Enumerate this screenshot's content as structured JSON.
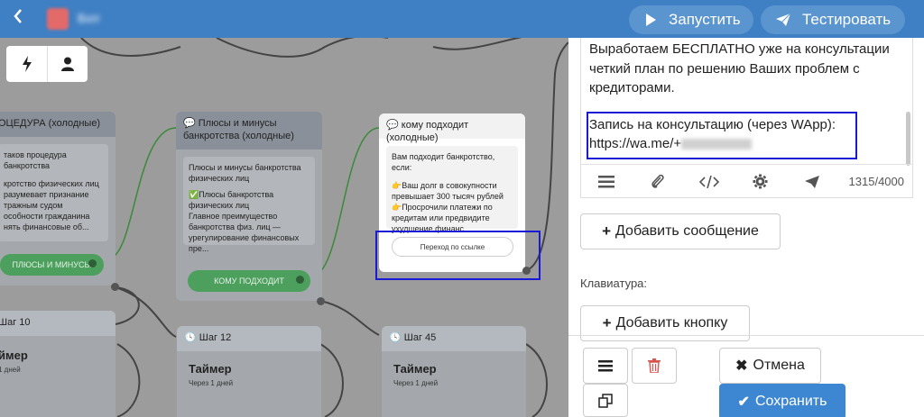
{
  "header": {
    "back_icon": "chevron-left-icon",
    "bot_name": "Бот",
    "run_label": "Запустить",
    "test_label": "Тестировать"
  },
  "canvas": {
    "card_procedure": {
      "title": "ОЦЕДУРА (холодные)",
      "message": [
        "таков процедура банкротства",
        "",
        "кротство физических лиц",
        "разумевает признание",
        "тражным судом",
        "особности гражданина",
        "нять финансовые об..."
      ],
      "button": "ПЛЮСЫ И МИНУСЫ"
    },
    "card_pros_cons": {
      "title": "Плюсы и минусы банкротства (холодные)",
      "message": [
        "Плюсы и минусы банкротства",
        "физических лиц",
        "",
        "✅Плюсы банкротства",
        "физических лиц",
        "Главное преимущество",
        "банкротства физ. лиц —",
        "урегулирование финансовых пре..."
      ],
      "button": "КОМУ ПОДХОДИТ"
    },
    "card_who_fits": {
      "title": "кому подходит (холодные)",
      "message": [
        "Вам подходит банкротство, если:",
        "",
        "👉Ваш долг в совокупности",
        "превышает 300 тысяч рублей",
        "👉Просрочили платежи по",
        "кредитам или предвидите",
        "ухудшение финанс..."
      ],
      "button": "Переход по ссылке"
    },
    "step_left": {
      "title": "Шаг 10",
      "timer": "ймер",
      "sub": "1 дней"
    },
    "step_12": {
      "title": "Шаг 12",
      "timer": "Таймер",
      "sub": "Через 1 дней"
    },
    "step_45": {
      "title": "Шаг 45",
      "timer": "Таймер",
      "sub": "Через 1 дней"
    }
  },
  "editor": {
    "paragraph1": "Выработаем БЕСПЛАТНО уже на консультации четкий план по решению Ваших проблем с кредиторами.",
    "paragraph2_line1": "Запись на консультацию (через WApp):",
    "paragraph2_url": "https://wa.me/+",
    "counter": "1315/4000"
  },
  "panel": {
    "add_message": "Добавить сообщение",
    "keyboard_label": "Клавиатура:",
    "add_button": "Добавить кнопку",
    "cancel": "Отмена",
    "save": "Сохранить"
  },
  "colors": {
    "header": "#3f7fc3",
    "header_button": "#5b95cf",
    "save": "#3d86d1",
    "delete": "#d9534f",
    "highlight": "#1a1ad6",
    "green": "#4c9f5d"
  }
}
